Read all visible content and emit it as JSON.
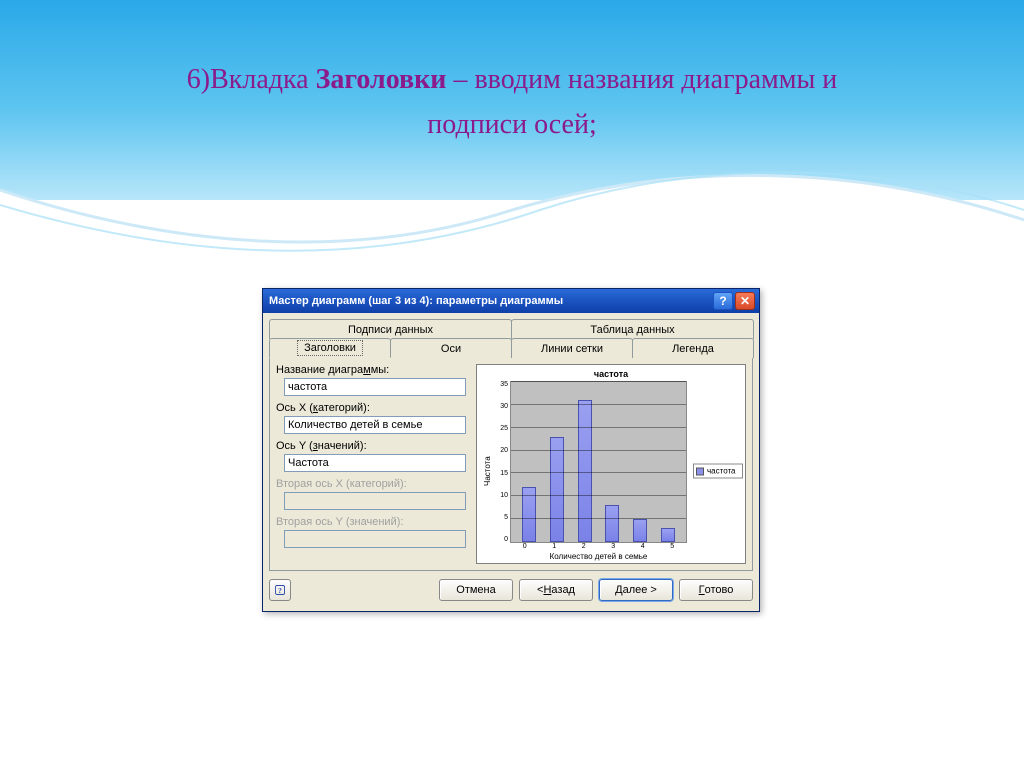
{
  "slide": {
    "line1_prefix": "6)Вкладка ",
    "line1_bold": "Заголовки",
    "line1_suffix": " – вводим названия диаграммы и",
    "line2": "подписи осей;"
  },
  "dialog": {
    "title": "Мастер диаграмм (шаг 3 из 4): параметры диаграммы",
    "help_symbol": "?",
    "close_symbol": "✕",
    "tabs_top": [
      {
        "label": "Подписи данных"
      },
      {
        "label": "Таблица данных"
      }
    ],
    "tabs_bottom": [
      {
        "label": "Заголовки",
        "active": true
      },
      {
        "label": "Оси"
      },
      {
        "label": "Линии сетки"
      },
      {
        "label": "Легенда"
      }
    ],
    "form": {
      "chart_title_label": "Название диаграммы:",
      "chart_title_value": "частота",
      "x_axis_label": "Ось X (категорий):",
      "x_axis_value": "Количество детей в семье",
      "y_axis_label": "Ось Y (значений):",
      "y_axis_value": "Частота",
      "x2_axis_label": "Вторая ось X (категорий):",
      "x2_axis_value": "",
      "y2_axis_label": "Вторая ось Y (значений):",
      "y2_axis_value": ""
    },
    "buttons": {
      "cancel": "Отмена",
      "back": "< Назад",
      "next": "Далее >",
      "finish": "Готово"
    }
  },
  "chart_data": {
    "type": "bar",
    "title": "частота",
    "xlabel": "Количество детей в семье",
    "ylabel": "Частота",
    "categories": [
      "0",
      "1",
      "2",
      "3",
      "4",
      "5"
    ],
    "values": [
      12,
      23,
      31,
      8,
      5,
      3
    ],
    "ylim": [
      0,
      35
    ],
    "yticks": [
      0,
      5,
      10,
      15,
      20,
      25,
      30,
      35
    ],
    "legend": [
      "частота"
    ],
    "grid": true
  }
}
